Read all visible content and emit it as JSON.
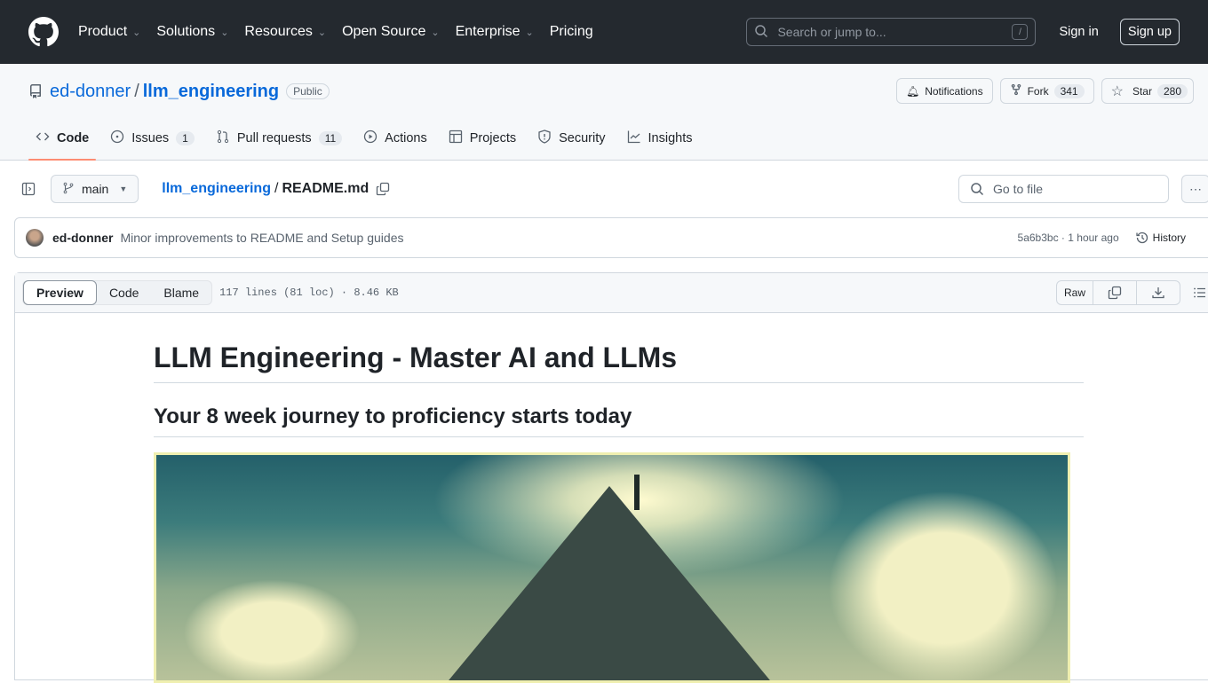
{
  "header": {
    "nav": [
      {
        "label": "Product",
        "dropdown": true
      },
      {
        "label": "Solutions",
        "dropdown": true
      },
      {
        "label": "Resources",
        "dropdown": true
      },
      {
        "label": "Open Source",
        "dropdown": true
      },
      {
        "label": "Enterprise",
        "dropdown": true
      },
      {
        "label": "Pricing",
        "dropdown": false
      }
    ],
    "search_placeholder": "Search or jump to...",
    "search_shortcut": "/",
    "sign_in": "Sign in",
    "sign_up": "Sign up"
  },
  "repo": {
    "owner": "ed-donner",
    "name": "llm_engineering",
    "visibility": "Public",
    "actions": {
      "notifications": "Notifications",
      "fork": "Fork",
      "fork_count": "341",
      "star": "Star",
      "star_count": "280"
    },
    "tabs": [
      {
        "label": "Code",
        "icon": "code-icon",
        "active": true
      },
      {
        "label": "Issues",
        "icon": "issue-icon",
        "count": "1"
      },
      {
        "label": "Pull requests",
        "icon": "pull-request-icon",
        "count": "11"
      },
      {
        "label": "Actions",
        "icon": "play-icon"
      },
      {
        "label": "Projects",
        "icon": "table-icon"
      },
      {
        "label": "Security",
        "icon": "shield-icon"
      },
      {
        "label": "Insights",
        "icon": "graph-icon"
      }
    ]
  },
  "file": {
    "branch": "main",
    "crumb_repo": "llm_engineering",
    "crumb_sep": "/",
    "filename": "README.md",
    "go_to_file": "Go to file",
    "commit": {
      "author": "ed-donner",
      "message": "Minor improvements to README and Setup guides",
      "sha": "5a6b3bc",
      "time": "1 hour ago",
      "sep": "·",
      "history": "History"
    },
    "view_tabs": [
      "Preview",
      "Code",
      "Blame"
    ],
    "info": "117 lines (81 loc) · 8.46 KB",
    "raw": "Raw"
  },
  "readme": {
    "h1": "LLM Engineering - Master AI and LLMs",
    "h2": "Your 8 week journey to proficiency starts today",
    "hero_alt": "Illustration of a mountain peak with radiant light"
  }
}
